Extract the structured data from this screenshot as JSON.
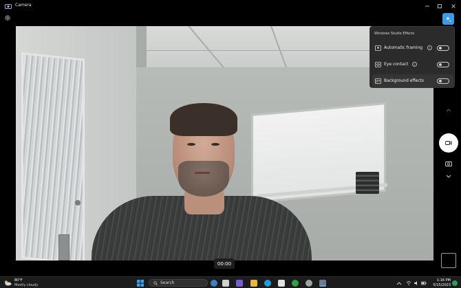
{
  "window": {
    "title": "Camera"
  },
  "timer": {
    "value": "00:00"
  },
  "effects_panel": {
    "title": "Windows Studio Effects",
    "items": [
      {
        "label": "Automatic framing",
        "has_info": true,
        "enabled": false,
        "icon": "framing-icon"
      },
      {
        "label": "Eye contact",
        "has_info": true,
        "enabled": false,
        "icon": "eye-contact-icon"
      },
      {
        "label": "Background effects",
        "has_info": false,
        "enabled": false,
        "icon": "background-effects-icon"
      }
    ]
  },
  "taskbar": {
    "weather": {
      "temp": "80°F",
      "desc": "Mostly cloudy"
    },
    "search": {
      "placeholder": "Search"
    },
    "clock": {
      "time": "1:16 PM",
      "date": "5/15/2023"
    }
  },
  "colors": {
    "accent": "#3a9ce6",
    "panel_bg": "#2b2b2b",
    "taskbar_bg": "#1c1c1c"
  }
}
